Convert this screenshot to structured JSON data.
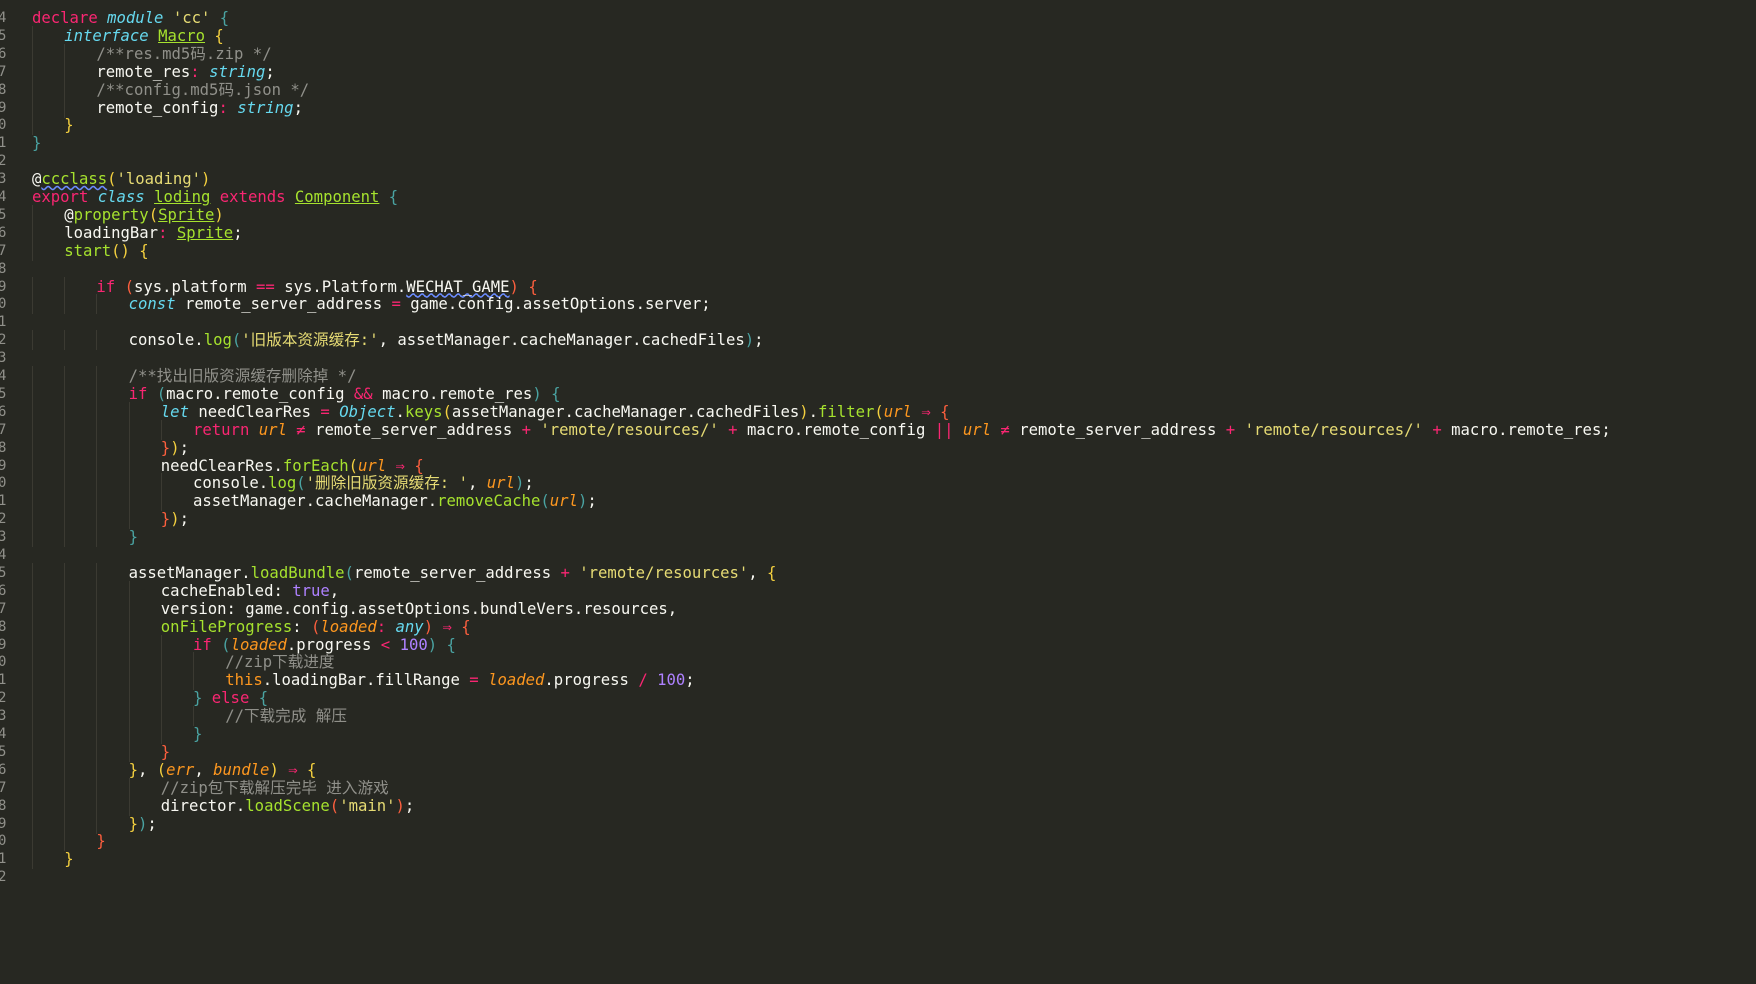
{
  "editor": {
    "language": "TypeScript",
    "theme_background": "#272822",
    "lines": [
      {
        "n": "4",
        "indent": 0,
        "html_key": "l4"
      },
      {
        "n": "5",
        "indent": 1,
        "html_key": "l5"
      },
      {
        "n": "6",
        "indent": 2,
        "html_key": "l6"
      },
      {
        "n": "7",
        "indent": 2,
        "html_key": "l7"
      },
      {
        "n": "8",
        "indent": 2,
        "html_key": "l8"
      },
      {
        "n": "9",
        "indent": 2,
        "html_key": "l9"
      },
      {
        "n": "0",
        "indent": 1,
        "html_key": "l10"
      },
      {
        "n": "1",
        "indent": 0,
        "html_key": "l11"
      },
      {
        "n": "2",
        "indent": 0,
        "html_key": "l12"
      },
      {
        "n": "3",
        "indent": 0,
        "html_key": "l13"
      },
      {
        "n": "4",
        "indent": 0,
        "html_key": "l14"
      },
      {
        "n": "5",
        "indent": 1,
        "html_key": "l15"
      },
      {
        "n": "6",
        "indent": 1,
        "html_key": "l16"
      },
      {
        "n": "7",
        "indent": 1,
        "html_key": "l17"
      },
      {
        "n": "8",
        "indent": 0,
        "html_key": "l18"
      },
      {
        "n": "9",
        "indent": 2,
        "html_key": "l19"
      },
      {
        "n": "0",
        "indent": 3,
        "html_key": "l20"
      },
      {
        "n": "1",
        "indent": 0,
        "html_key": "l21"
      },
      {
        "n": "2",
        "indent": 3,
        "html_key": "l22"
      },
      {
        "n": "3",
        "indent": 0,
        "html_key": "l23"
      },
      {
        "n": "4",
        "indent": 3,
        "html_key": "l24"
      },
      {
        "n": "5",
        "indent": 3,
        "html_key": "l25"
      },
      {
        "n": "6",
        "indent": 4,
        "html_key": "l26"
      },
      {
        "n": "7",
        "indent": 5,
        "html_key": "l27"
      },
      {
        "n": "8",
        "indent": 4,
        "html_key": "l28"
      },
      {
        "n": "9",
        "indent": 4,
        "html_key": "l29"
      },
      {
        "n": "0",
        "indent": 5,
        "html_key": "l30"
      },
      {
        "n": "1",
        "indent": 5,
        "html_key": "l31"
      },
      {
        "n": "2",
        "indent": 4,
        "html_key": "l32"
      },
      {
        "n": "3",
        "indent": 3,
        "html_key": "l33"
      },
      {
        "n": "4",
        "indent": 0,
        "html_key": "l34"
      },
      {
        "n": "5",
        "indent": 3,
        "html_key": "l35"
      },
      {
        "n": "6",
        "indent": 4,
        "html_key": "l36"
      },
      {
        "n": "7",
        "indent": 4,
        "html_key": "l37"
      },
      {
        "n": "8",
        "indent": 4,
        "html_key": "l38"
      },
      {
        "n": "9",
        "indent": 5,
        "html_key": "l39"
      },
      {
        "n": "0",
        "indent": 6,
        "html_key": "l40"
      },
      {
        "n": "1",
        "indent": 6,
        "html_key": "l41"
      },
      {
        "n": "2",
        "indent": 5,
        "html_key": "l42"
      },
      {
        "n": "3",
        "indent": 6,
        "html_key": "l43"
      },
      {
        "n": "4",
        "indent": 5,
        "html_key": "l44"
      },
      {
        "n": "5",
        "indent": 4,
        "html_key": "l45"
      },
      {
        "n": "6",
        "indent": 3,
        "html_key": "l46"
      },
      {
        "n": "7",
        "indent": 4,
        "html_key": "l47"
      },
      {
        "n": "8",
        "indent": 4,
        "html_key": "l48"
      },
      {
        "n": "9",
        "indent": 3,
        "html_key": "l49"
      },
      {
        "n": "0",
        "indent": 2,
        "html_key": "l50"
      },
      {
        "n": "1",
        "indent": 1,
        "html_key": "l51"
      },
      {
        "n": "2",
        "indent": 0,
        "html_key": "l52"
      }
    ]
  },
  "tokens": {
    "l4": [
      [
        "kw",
        "declare "
      ],
      [
        "kwi",
        "module "
      ],
      [
        "str",
        "'cc' "
      ],
      [
        "br3",
        "{"
      ]
    ],
    "l5": [
      [
        "kwi",
        "interface "
      ],
      [
        "cls",
        "Macro"
      ],
      [
        "dec",
        " "
      ],
      [
        "br1",
        "{"
      ]
    ],
    "l6": [
      [
        "cmt",
        "/**res.md5码.zip */"
      ]
    ],
    "l7": [
      [
        "dec",
        "remote_res"
      ],
      [
        "op",
        ": "
      ],
      [
        "typ",
        "string"
      ],
      [
        "dec",
        ";"
      ]
    ],
    "l8": [
      [
        "cmt",
        "/**config.md5码.json */"
      ]
    ],
    "l9": [
      [
        "dec",
        "remote_config"
      ],
      [
        "op",
        ": "
      ],
      [
        "typ",
        "string"
      ],
      [
        "dec",
        ";"
      ]
    ],
    "l10": [
      [
        "br1",
        "}"
      ]
    ],
    "l11": [
      [
        "br3",
        "}"
      ]
    ],
    "l12": [],
    "l13": [
      [
        "dec",
        "@"
      ],
      [
        "decn",
        "ccclass"
      ],
      [
        "br1",
        "("
      ],
      [
        "str",
        "'loading'"
      ],
      [
        "br1",
        ")"
      ]
    ],
    "l14": [
      [
        "kw",
        "export "
      ],
      [
        "kwi",
        "class "
      ],
      [
        "cls",
        "loding"
      ],
      [
        "dec",
        " "
      ],
      [
        "kw",
        "extends "
      ],
      [
        "cls",
        "Component"
      ],
      [
        "dec",
        " "
      ],
      [
        "br3",
        "{"
      ]
    ],
    "l15": [
      [
        "dec",
        "@"
      ],
      [
        "fn",
        "property"
      ],
      [
        "br1",
        "("
      ],
      [
        "cls",
        "Sprite"
      ],
      [
        "br1",
        ")"
      ]
    ],
    "l16": [
      [
        "dec",
        "loadingBar"
      ],
      [
        "op",
        ": "
      ],
      [
        "cls",
        "Sprite"
      ],
      [
        "dec",
        ";"
      ]
    ],
    "l17": [
      [
        "fn",
        "start"
      ],
      [
        "br1",
        "() {"
      ]
    ],
    "l18": [],
    "l19": [
      [
        "kw",
        "if "
      ],
      [
        "br2",
        "("
      ],
      [
        "dec",
        "sys.platform "
      ],
      [
        "op",
        "== "
      ],
      [
        "dec",
        "sys.Platform."
      ],
      [
        "wavy",
        "WECHAT_GAME"
      ],
      [
        "br2",
        ")"
      ],
      [
        "dec",
        " "
      ],
      [
        "br2",
        "{"
      ]
    ],
    "l20": [
      [
        "kwi",
        "const "
      ],
      [
        "dec",
        "remote_server_address "
      ],
      [
        "op",
        "= "
      ],
      [
        "dec",
        "game.config.assetOptions.server;"
      ]
    ],
    "l21": [],
    "l22": [
      [
        "dec",
        "console."
      ],
      [
        "fn",
        "log"
      ],
      [
        "br3",
        "("
      ],
      [
        "str",
        "'旧版本资源缓存:'"
      ],
      [
        "dec",
        ", assetManager.cacheManager.cachedFiles"
      ],
      [
        "br3",
        ")"
      ],
      [
        "dec",
        ";"
      ]
    ],
    "l23": [],
    "l24": [
      [
        "cmt",
        "/**找出旧版资源缓存删除掉 */"
      ]
    ],
    "l25": [
      [
        "kw",
        "if "
      ],
      [
        "br3",
        "("
      ],
      [
        "dec",
        "macro.remote_config "
      ],
      [
        "op",
        "&& "
      ],
      [
        "dec",
        "macro.remote_res"
      ],
      [
        "br3",
        ")"
      ],
      [
        "dec",
        " "
      ],
      [
        "br3",
        "{"
      ]
    ],
    "l26": [
      [
        "kwi",
        "let "
      ],
      [
        "dec",
        "needClearRes "
      ],
      [
        "op",
        "= "
      ],
      [
        "typ",
        "Object"
      ],
      [
        "dec",
        "."
      ],
      [
        "fn",
        "keys"
      ],
      [
        "br1",
        "("
      ],
      [
        "dec",
        "assetManager.cacheManager.cachedFiles"
      ],
      [
        "br1",
        ")"
      ],
      [
        "dec",
        "."
      ],
      [
        "fn",
        "filter"
      ],
      [
        "br1",
        "("
      ],
      [
        "prm",
        "url"
      ],
      [
        "dec",
        " "
      ],
      [
        "op",
        "⇒ "
      ],
      [
        "br2",
        "{"
      ]
    ],
    "l27": [
      [
        "kw",
        "return "
      ],
      [
        "prm",
        "url"
      ],
      [
        "dec",
        " "
      ],
      [
        "op",
        "≠ "
      ],
      [
        "dec",
        "remote_server_address "
      ],
      [
        "op",
        "+ "
      ],
      [
        "str",
        "'remote/resources/'"
      ],
      [
        "dec",
        " "
      ],
      [
        "op",
        "+ "
      ],
      [
        "dec",
        "macro.remote_config "
      ],
      [
        "op",
        "|| "
      ],
      [
        "prm",
        "url"
      ],
      [
        "dec",
        " "
      ],
      [
        "op",
        "≠ "
      ],
      [
        "dec",
        "remote_server_address "
      ],
      [
        "op",
        "+ "
      ],
      [
        "str",
        "'remote/resources/'"
      ],
      [
        "dec",
        " "
      ],
      [
        "op",
        "+ "
      ],
      [
        "dec",
        "macro.remote_res;"
      ]
    ],
    "l28": [
      [
        "br2",
        "}"
      ],
      [
        "br1",
        ")"
      ],
      [
        "dec",
        ";"
      ]
    ],
    "l29": [
      [
        "dec",
        "needClearRes."
      ],
      [
        "fn",
        "forEach"
      ],
      [
        "br1",
        "("
      ],
      [
        "prm",
        "url"
      ],
      [
        "dec",
        " "
      ],
      [
        "op",
        "⇒ "
      ],
      [
        "br2",
        "{"
      ]
    ],
    "l30": [
      [
        "dec",
        "console."
      ],
      [
        "fn",
        "log"
      ],
      [
        "br3",
        "("
      ],
      [
        "str",
        "'删除旧版资源缓存: '"
      ],
      [
        "dec",
        ", "
      ],
      [
        "prm",
        "url"
      ],
      [
        "br3",
        ")"
      ],
      [
        "dec",
        ";"
      ]
    ],
    "l31": [
      [
        "dec",
        "assetManager.cacheManager."
      ],
      [
        "fn",
        "removeCache"
      ],
      [
        "br3",
        "("
      ],
      [
        "prm",
        "url"
      ],
      [
        "br3",
        ")"
      ],
      [
        "dec",
        ";"
      ]
    ],
    "l32": [
      [
        "br2",
        "}"
      ],
      [
        "br1",
        ")"
      ],
      [
        "dec",
        ";"
      ]
    ],
    "l33": [
      [
        "br3",
        "}"
      ]
    ],
    "l34": [],
    "l35": [
      [
        "dec",
        "assetManager."
      ],
      [
        "fn",
        "loadBundle"
      ],
      [
        "br3",
        "("
      ],
      [
        "dec",
        "remote_server_address "
      ],
      [
        "op",
        "+ "
      ],
      [
        "str",
        "'remote/resources'"
      ],
      [
        "dec",
        ", "
      ],
      [
        "br1",
        "{"
      ]
    ],
    "l36": [
      [
        "dec",
        "cacheEnabled: "
      ],
      [
        "num",
        "true"
      ],
      [
        "dec",
        ","
      ]
    ],
    "l37": [
      [
        "dec",
        "version: game.config.assetOptions.bundleVers.resources,"
      ]
    ],
    "l38": [
      [
        "fn",
        "onFileProgress"
      ],
      [
        "dec",
        ": "
      ],
      [
        "br2",
        "("
      ],
      [
        "prm",
        "loaded"
      ],
      [
        "op",
        ": "
      ],
      [
        "typ",
        "any"
      ],
      [
        "br2",
        ")"
      ],
      [
        "dec",
        " "
      ],
      [
        "op",
        "⇒ "
      ],
      [
        "br2",
        "{"
      ]
    ],
    "l39": [
      [
        "kw",
        "if "
      ],
      [
        "br3",
        "("
      ],
      [
        "prm",
        "loaded"
      ],
      [
        "dec",
        ".progress "
      ],
      [
        "op",
        "< "
      ],
      [
        "num",
        "100"
      ],
      [
        "br3",
        ")"
      ],
      [
        "dec",
        " "
      ],
      [
        "br3",
        "{"
      ]
    ],
    "l40": [
      [
        "cmt",
        "//zip下载进度"
      ]
    ],
    "l41": [
      [
        "thisk",
        "this"
      ],
      [
        "dec",
        ".loadingBar.fillRange "
      ],
      [
        "op",
        "= "
      ],
      [
        "prm",
        "loaded"
      ],
      [
        "dec",
        ".progress "
      ],
      [
        "op",
        "/ "
      ],
      [
        "num",
        "100"
      ],
      [
        "dec",
        ";"
      ]
    ],
    "l42": [
      [
        "br3",
        "} "
      ],
      [
        "kw",
        "else "
      ],
      [
        "br3",
        "{"
      ]
    ],
    "l43": [
      [
        "cmt",
        "//下载完成 解压"
      ]
    ],
    "l44": [
      [
        "br3",
        "}"
      ]
    ],
    "l45": [
      [
        "br2",
        "}"
      ]
    ],
    "l46": [
      [
        "br1",
        "}"
      ],
      [
        "dec",
        ", "
      ],
      [
        "br1",
        "("
      ],
      [
        "prm",
        "err"
      ],
      [
        "dec",
        ", "
      ],
      [
        "prm",
        "bundle"
      ],
      [
        "br1",
        ")"
      ],
      [
        "dec",
        " "
      ],
      [
        "op",
        "⇒ "
      ],
      [
        "br1",
        "{"
      ]
    ],
    "l47": [
      [
        "cmt",
        "//zip包下载解压完毕 进入游戏"
      ]
    ],
    "l48": [
      [
        "dec",
        "director."
      ],
      [
        "fn",
        "loadScene"
      ],
      [
        "br2",
        "("
      ],
      [
        "str",
        "'main'"
      ],
      [
        "br2",
        ")"
      ],
      [
        "dec",
        ";"
      ]
    ],
    "l49": [
      [
        "br1",
        "}"
      ],
      [
        "br3",
        ")"
      ],
      [
        "dec",
        ";"
      ]
    ],
    "l50": [
      [
        "br2",
        "}"
      ]
    ],
    "l51": [
      [
        "br1",
        "}"
      ]
    ],
    "l52": []
  }
}
